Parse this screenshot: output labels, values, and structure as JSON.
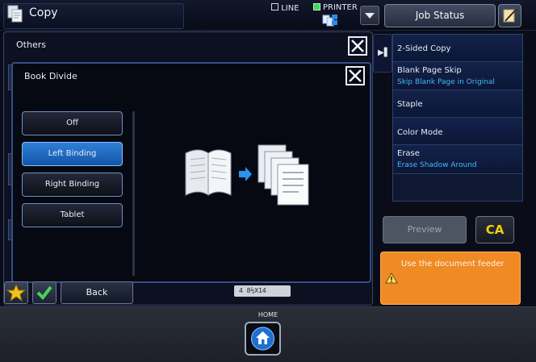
{
  "header": {
    "mode_title": "Copy",
    "line_label": "LINE",
    "printer_label": "PRINTER",
    "job_status_label": "Job Status"
  },
  "others_dialog": {
    "title": "Others"
  },
  "book_divide_dialog": {
    "title": "Book Divide",
    "options": [
      {
        "label": "Off",
        "selected": false
      },
      {
        "label": "Left Binding",
        "selected": true
      },
      {
        "label": "Right Binding",
        "selected": false
      },
      {
        "label": "Tablet",
        "selected": false
      }
    ]
  },
  "right_panel": {
    "items": [
      {
        "label": "2-Sided Copy",
        "sub": ""
      },
      {
        "label": "Blank Page Skip",
        "sub": "Skip Blank Page in Original"
      },
      {
        "label": "Staple",
        "sub": ""
      },
      {
        "label": "Color Mode",
        "sub": ""
      },
      {
        "label": "Erase",
        "sub": "Erase Shadow Around"
      }
    ],
    "preview_label": "Preview",
    "ca_label": "CA",
    "message": "Use the document feeder"
  },
  "bottom": {
    "back_label": "Back",
    "paper_indicator": "4 8½X14",
    "home_label": "HOME"
  },
  "colors": {
    "accent_blue": "#1a6fd0",
    "warning_orange": "#f08a24",
    "ca_yellow": "#f5d000",
    "printer_green": "#43d35b",
    "subtext_blue": "#45b6ff"
  }
}
